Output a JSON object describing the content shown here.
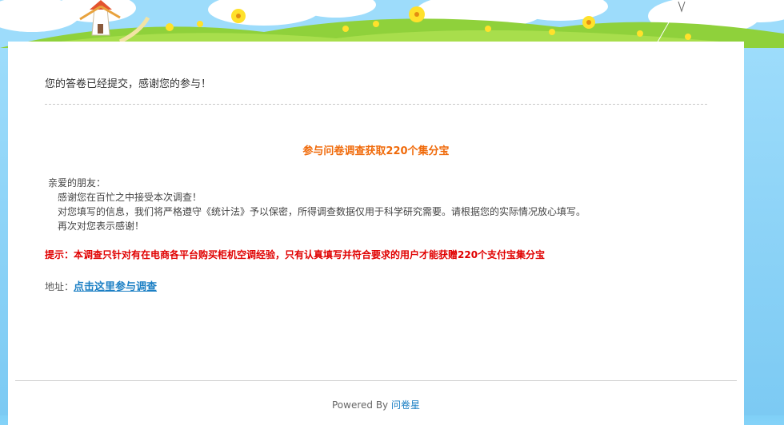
{
  "message": "您的答卷已经提交，感谢您的参与！",
  "survey": {
    "title": "参与问卷调查获取220个集分宝",
    "greeting": "亲爱的朋友：",
    "lines": [
      "感谢您在百忙之中接受本次调查！",
      "对您填写的信息，我们将严格遵守《统计法》予以保密，所得调查数据仅用于科学研究需要。请根据您的实际情况放心填写。",
      "再次对您表示感谢！"
    ],
    "tip": "提示：本调查只针对有在电商各平台购买柜机空调经验，只有认真填写并符合要求的用户才能获赠220个支付宝集分宝",
    "address_label": "地址：",
    "address_link": "点击这里参与调查"
  },
  "footer": {
    "powered_by": "Powered By",
    "brand_link": "问卷星"
  },
  "colors": {
    "accent_orange": "#f06a0a",
    "tip_red": "#e00000",
    "link_blue": "#1b7fc4"
  }
}
